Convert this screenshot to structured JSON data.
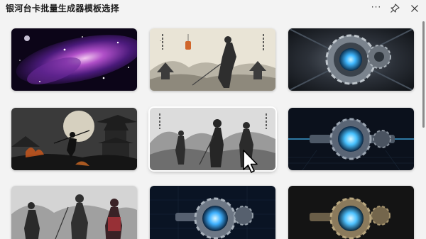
{
  "window": {
    "title": "银河台卡批量生成器模板选择",
    "more_label": "···",
    "pin_icon": "pin-icon",
    "close_icon": "close-icon"
  },
  "templates": [
    {
      "theme": "galaxy-nebula",
      "colors": [
        "#1a0b2e",
        "#7b3fa8",
        "#e8a6e0"
      ]
    },
    {
      "theme": "ink-swordsman-lantern",
      "colors": [
        "#e6e0d2",
        "#3b3b3b",
        "#c8642a"
      ]
    },
    {
      "theme": "mechanical-gear-blue-core",
      "colors": [
        "#1c2128",
        "#8a949e",
        "#3fb7ff"
      ]
    },
    {
      "theme": "moonlit-pagoda-fire",
      "colors": [
        "#2a2a2a",
        "#cfc9b8",
        "#c7561c"
      ]
    },
    {
      "theme": "ink-warriors-mist",
      "colors": [
        "#d9d9d9",
        "#2e2e2e",
        "#8a8a8a"
      ]
    },
    {
      "theme": "mechanical-gear-dark",
      "colors": [
        "#0d1320",
        "#5a6575",
        "#48c2ff"
      ]
    },
    {
      "theme": "ink-warriors-red-armor",
      "colors": [
        "#d0d0d0",
        "#333333",
        "#a8323a"
      ]
    },
    {
      "theme": "mechanical-gear-grid",
      "colors": [
        "#0a1424",
        "#6d7785",
        "#3fb1ff"
      ]
    },
    {
      "theme": "mechanical-gear-bronze",
      "colors": [
        "#141414",
        "#8b7a5c",
        "#4fc3ff"
      ]
    }
  ]
}
